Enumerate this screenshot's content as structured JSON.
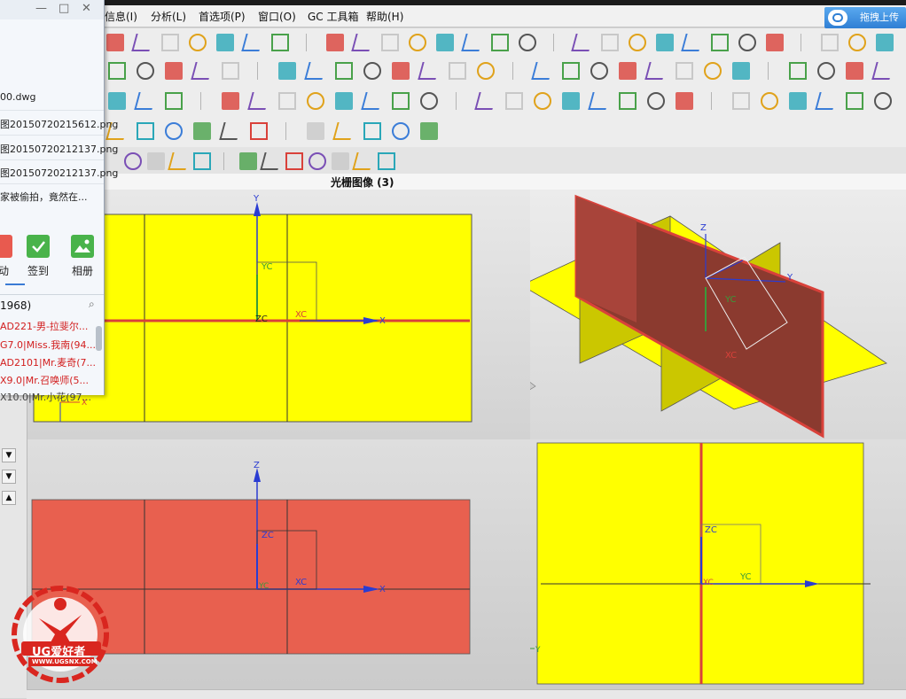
{
  "menu": [
    "信息(I)",
    "分析(L)",
    "首选项(P)",
    "窗口(O)",
    "GC 工具箱",
    "帮助(H)"
  ],
  "upload_button": "拖拽上传",
  "view_title": "光栅图像 (3)",
  "chat_panel": {
    "files": [
      "00.dwg",
      "图20150720215612.png",
      "图20150720212137.png",
      "图20150720212137.png"
    ],
    "message": "家被偷拍，竟然在...",
    "apps": [
      "动",
      "签到",
      "相册"
    ],
    "count": "1968)",
    "users": [
      "AD221-男-拉斐尔...",
      "G7.0|Miss.我南(94...",
      "AD2101|Mr.麦奇(7...",
      "X9.0|Mr.召唤师(5...",
      "X10.0|Mr.小花(97..."
    ]
  },
  "axis_labels": {
    "x": "X",
    "y": "Y",
    "z": "Z",
    "xc": "XC",
    "yc": "YC",
    "zc": "ZC"
  },
  "watermark": {
    "brand": "UG爱好者",
    "url": "WWW.UGSNX.COM"
  },
  "colors": {
    "yellow_plane": "#ffff00",
    "red_plane": "#e8604f",
    "dark_red_plane": "#8b3a2f",
    "accent_red": "#d9413a",
    "axis_blue": "#2a3cd2"
  }
}
